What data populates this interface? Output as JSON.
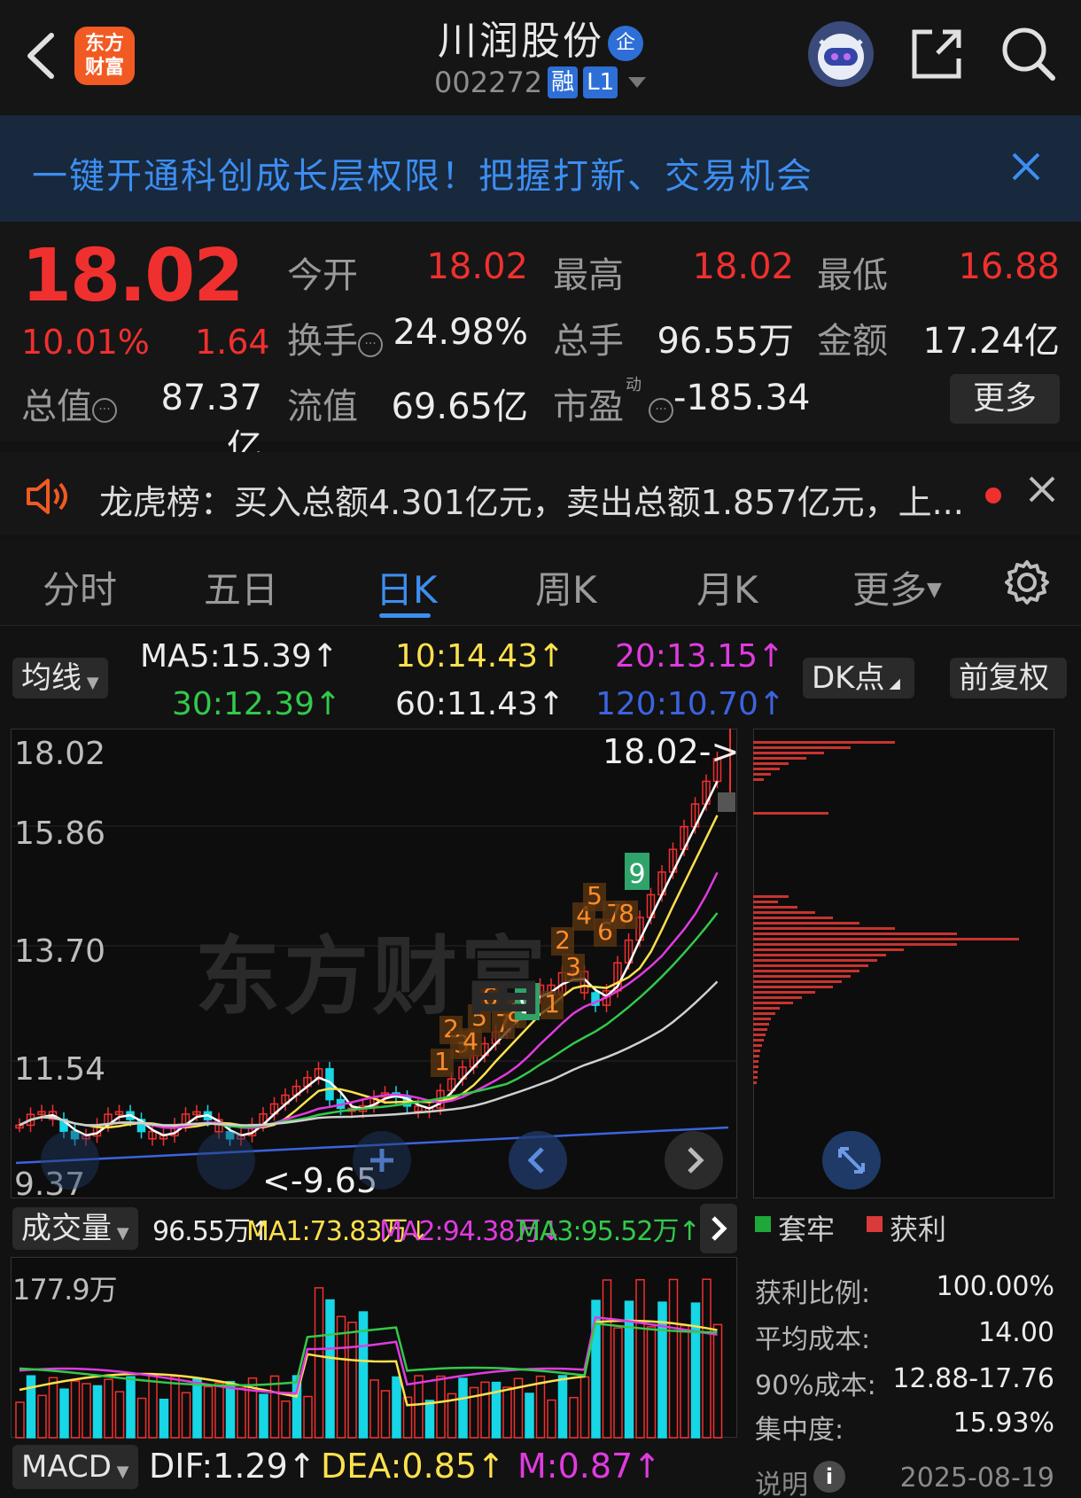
{
  "header": {
    "logo_line1": "东方",
    "logo_line2": "财富",
    "title": "川润股份",
    "title_badge": "企",
    "code": "002272",
    "tag_margin": "融",
    "tag_level": "L1"
  },
  "banner": {
    "text": "一键开通科创成长层权限！把握打新、交易机会"
  },
  "quote": {
    "price": "18.02",
    "change_pct": "10.01%",
    "change_abs": "1.64",
    "open_label": "今开",
    "open": "18.02",
    "high_label": "最高",
    "high": "18.02",
    "low_label": "最低",
    "low": "16.88",
    "turnover_label": "换手",
    "turnover": "24.98%",
    "volume_label": "总手",
    "volume": "96.55万",
    "amount_label": "金额",
    "amount": "17.24亿",
    "mktcap_label": "总值",
    "mktcap": "87.37亿",
    "float_label": "流值",
    "float": "69.65亿",
    "pe_label": "市盈",
    "pe_sup": "动",
    "pe": "-185.34",
    "more": "更多"
  },
  "notice": {
    "text": "龙虎榜：买入总额4.301亿元，卖出总额1.857亿元，上..."
  },
  "tabs": [
    "分时",
    "五日",
    "日K",
    "周K",
    "月K",
    "更多"
  ],
  "active_tab": "日K",
  "ma_bar": {
    "selector": "均线",
    "ma5": "MA5:15.39↑",
    "ma10": "10:14.43↑",
    "ma20": "20:13.15↑",
    "ma30": "30:12.39↑",
    "ma60": "60:11.43↑",
    "ma120": "120:10.70↑",
    "dk": "DK点",
    "adjust": "前复权"
  },
  "kline": {
    "y_ticks": [
      "18.02",
      "15.86",
      "13.70",
      "11.54",
      "9.37"
    ],
    "high_marker": "18.02->",
    "low_marker": "<-9.65",
    "watermark": "东方财富",
    "td_numbers_orange": [
      "1",
      "2",
      "3",
      "4",
      "5",
      "6",
      "7",
      "8",
      "1",
      "2",
      "3",
      "4",
      "5",
      "6",
      "7",
      "8"
    ],
    "td_nine": "9",
    "colors": {
      "up": "#f0302f",
      "down": "#17d6e6",
      "ma5": "#ffffff",
      "ma10": "#ffe14d",
      "ma20": "#e03be0",
      "ma30": "#33c94a",
      "ma60": "#d0d0d0",
      "ma120": "#3d63e0"
    }
  },
  "volume_bar": {
    "selector": "成交量",
    "vol": "96.55万↑",
    "ma1": "MA1:73.83万↓",
    "ma2": "MA2:94.38万↓",
    "ma3": "MA3:95.52万↑",
    "top_tick": "177.9万"
  },
  "chip": {
    "legend_trapped": "套牢",
    "legend_profit": "获利",
    "profit_ratio_label": "获利比例:",
    "profit_ratio": "100.00%",
    "avg_cost_label": "平均成本:",
    "avg_cost": "14.00",
    "cost90_label": "90%成本:",
    "cost90": "12.88-17.76",
    "concentration_label": "集中度:",
    "concentration": "15.93%",
    "explain_label": "说明",
    "date": "2025-08-19"
  },
  "macd_bar": {
    "selector": "MACD",
    "dif": "DIF:1.29↑",
    "dea": "DEA:0.85↑",
    "m": "M:0.87↑"
  }
}
